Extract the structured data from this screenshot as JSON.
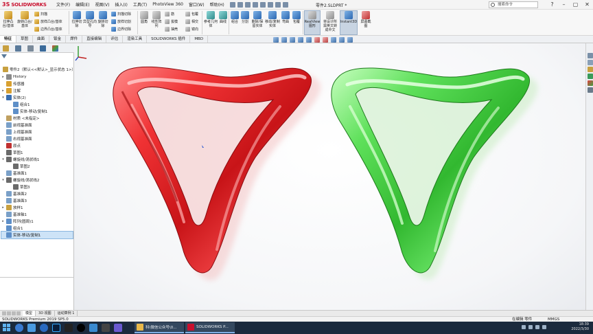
{
  "app": {
    "brand_ds": "3S",
    "brand_name": "SOLIDWORKS",
    "menus": [
      "文件(F)",
      "编辑(E)",
      "视图(V)",
      "插入(I)",
      "工具(T)",
      "PhotoView 360",
      "窗口(W)",
      "帮助(H)"
    ],
    "document_title": "零件2.SLDPRT *",
    "search_placeholder": "搜索命令",
    "win_controls": [
      "?",
      "–",
      "▢",
      "✕"
    ]
  },
  "ribbon": {
    "extrude_boss": "拉伸凸台/基体",
    "revolve_boss": "旋转凸台/基体",
    "sweep": "扫描",
    "loft_boss": "放样凸台/基体",
    "boundary_boss": "边界凸台/基体",
    "extrude_cut": "拉伸切除",
    "hole_wizard": "异型孔向导",
    "revolve_cut": "旋转切除",
    "sweep_cut": "扫描切除",
    "loft_cut": "放样切割",
    "boundary_cut": "边界切除",
    "fillet": "圆角",
    "linear_pattern": "线性阵列",
    "rib": "筋",
    "draft": "拔模",
    "shell": "抽壳",
    "wrap": "包覆",
    "intersect": "相交",
    "mirror": "镜向",
    "reference_geometry": "参考几何体",
    "curves": "曲线",
    "combine": "组合",
    "split": "分割",
    "delete_keep_body": "删除/保留实体",
    "move_copy_body": "移动/复制实体",
    "flex": "弯曲",
    "wrap2": "包覆",
    "realview": "RealView 图形",
    "bom_translate": "将设计所需英文转成中文",
    "instant3d": "Instant3D",
    "screenshot": "屏幕截图"
  },
  "tabs": [
    "特征",
    "草图",
    "曲面",
    "钣金",
    "焊件",
    "直接编辑",
    "评估",
    "渲染工具",
    "SOLIDWORKS 插件",
    "MBD"
  ],
  "active_tab": "特征",
  "tree": {
    "root": "零件2（默认<<默认>_显示状态 1>）",
    "items": [
      {
        "label": "History",
        "level": 1,
        "twisty": "▸",
        "color": "#8a8a8a"
      },
      {
        "label": "传感器",
        "level": 1,
        "twisty": "",
        "color": "#d8a030"
      },
      {
        "label": "注解",
        "level": 1,
        "twisty": "▸",
        "color": "#d8a030"
      },
      {
        "label": "实体(2)",
        "level": 1,
        "twisty": "▾",
        "color": "#3a6fb0"
      },
      {
        "label": "组合1",
        "level": 2,
        "twisty": "",
        "color": "#5e8fc8"
      },
      {
        "label": "实体-移动/复制1",
        "level": 2,
        "twisty": "",
        "color": "#5e8fc8"
      },
      {
        "label": "材质 <未指定>",
        "level": 1,
        "twisty": "",
        "color": "#c0a060"
      },
      {
        "label": "前视基准面",
        "level": 1,
        "twisty": "",
        "color": "#7aa0c8"
      },
      {
        "label": "上视基准面",
        "level": 1,
        "twisty": "",
        "color": "#7aa0c8"
      },
      {
        "label": "右视基准面",
        "level": 1,
        "twisty": "",
        "color": "#7aa0c8"
      },
      {
        "label": "原点",
        "level": 1,
        "twisty": "",
        "color": "#c03030"
      },
      {
        "label": "草图1",
        "level": 1,
        "twisty": "",
        "color": "#6a6a6a"
      },
      {
        "label": "螺旋线/涡状线1",
        "level": 1,
        "twisty": "▾",
        "color": "#6a6a6a"
      },
      {
        "label": "草图2",
        "level": 2,
        "twisty": "",
        "color": "#6a6a6a"
      },
      {
        "label": "基准面1",
        "level": 1,
        "twisty": "",
        "color": "#7aa0c8"
      },
      {
        "label": "螺旋线/涡状线2",
        "level": 1,
        "twisty": "▾",
        "color": "#6a6a6a"
      },
      {
        "label": "草图3",
        "level": 2,
        "twisty": "",
        "color": "#6a6a6a"
      },
      {
        "label": "基准面2",
        "level": 1,
        "twisty": "",
        "color": "#7aa0c8"
      },
      {
        "label": "基准面3",
        "level": 1,
        "twisty": "",
        "color": "#7aa0c8"
      },
      {
        "label": "放样1",
        "level": 1,
        "twisty": "▸",
        "color": "#c8a040"
      },
      {
        "label": "基准轴1",
        "level": 1,
        "twisty": "",
        "color": "#7aa0c8"
      },
      {
        "label": "阵列(圆周)1",
        "level": 1,
        "twisty": "▸",
        "color": "#5e8fc8"
      },
      {
        "label": "组合1",
        "level": 1,
        "twisty": "",
        "color": "#5e8fc8"
      },
      {
        "label": "实体-移动/复制1",
        "level": 1,
        "twisty": "",
        "color": "#5e8fc8",
        "selected": true
      }
    ]
  },
  "bottom_tabs": [
    "模型",
    "3D 视图",
    "运动算例 1"
  ],
  "status": {
    "version": "SOLIDWORKS Premium 2019 SP5.0",
    "mode": "在编辑 零件",
    "units": "MMGS"
  },
  "taskbar": {
    "apps": [
      {
        "label": "科\\微信公众号\\0...",
        "color": "#e8b84a"
      },
      {
        "label": "SOLIDWORKS P...",
        "color": "#c8102e"
      }
    ],
    "time": "18:39",
    "date": "2022/3/30"
  },
  "model_colors": {
    "red": "#e8262a",
    "green": "#4fd64a"
  }
}
